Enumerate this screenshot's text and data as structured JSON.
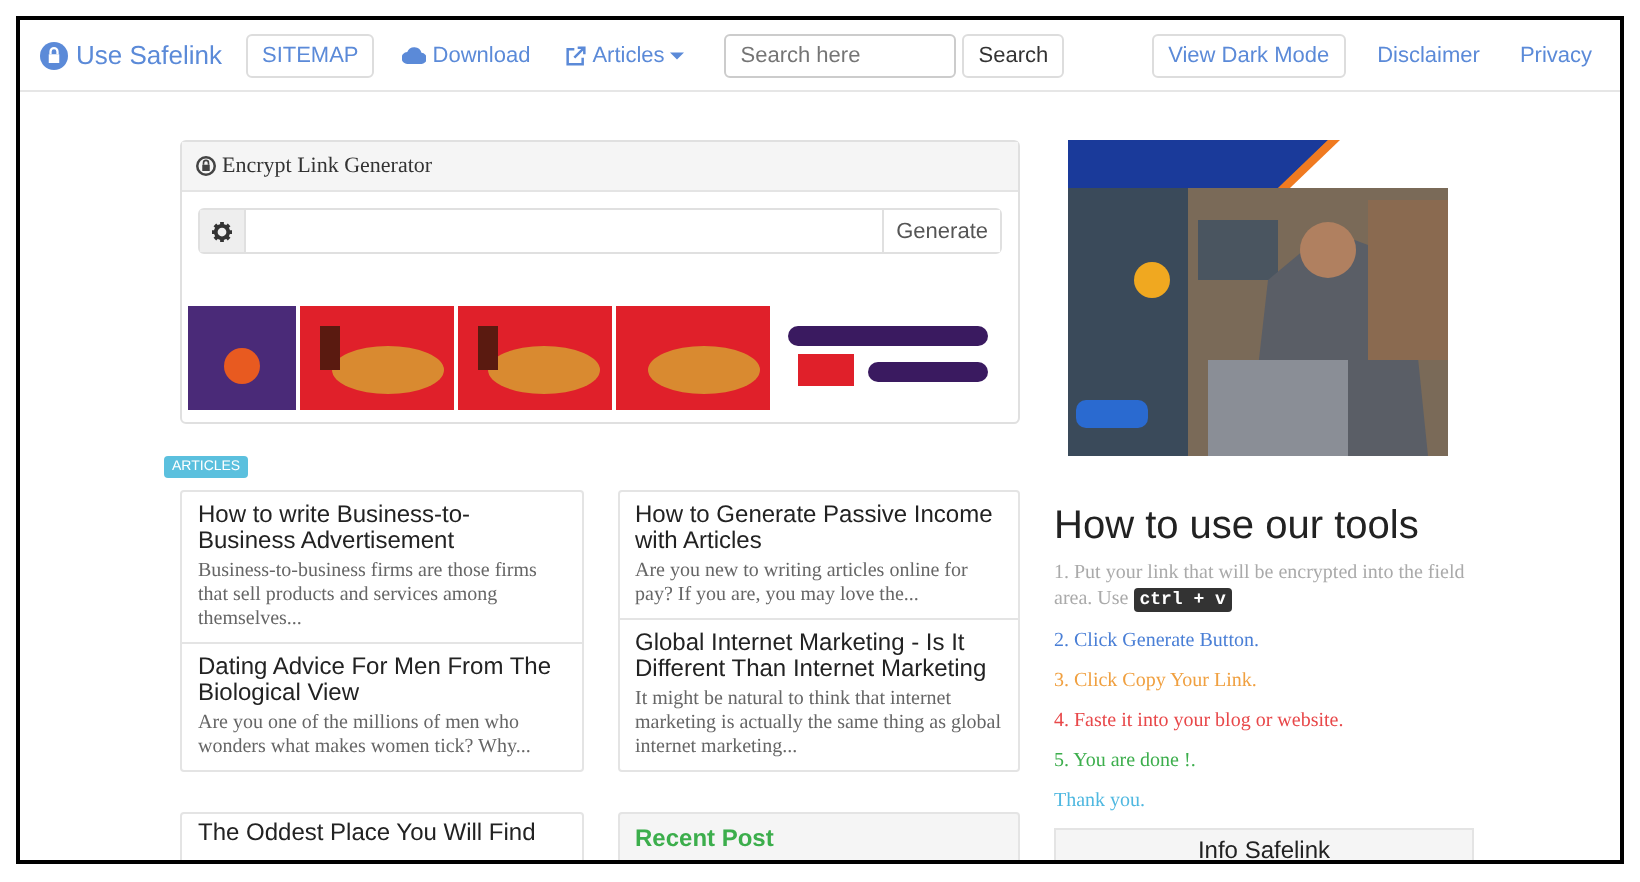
{
  "navbar": {
    "brand": "Use Safelink",
    "sitemap": "SITEMAP",
    "download": "Download",
    "articles": "Articles",
    "search": {
      "placeholder": "Search here",
      "button": "Search"
    },
    "dark_mode": "View Dark Mode",
    "disclaimer": "Disclaimer",
    "privacy": "Privacy"
  },
  "generator": {
    "title": "Encrypt Link Generator",
    "button": "Generate"
  },
  "articles": {
    "badge": "ARTICLES",
    "items": [
      {
        "title": "How to write Business-to-Business Advertisement",
        "excerpt": "Business-to-business firms are those firms that sell products and services among themselves..."
      },
      {
        "title": "Dating Advice For Men From The Biological View",
        "excerpt": "Are you one of the millions of men who wonders what makes women tick? Why..."
      },
      {
        "title": "How to Generate Passive Income with Articles",
        "excerpt": "Are you new to writing articles online for pay? If you are, you may love the..."
      },
      {
        "title": "Global Internet Marketing - Is It Different Than Internet Marketing",
        "excerpt": "It might be natural to think that internet marketing is actually the same thing as global internet marketing..."
      }
    ],
    "next_title": "The Oddest Place You Will Find",
    "recent_post": "Recent Post"
  },
  "sidebar": {
    "title": "How to use our tools",
    "steps": [
      {
        "text": "1. Put your link that will be encrypted into the field area. Use",
        "kbd": "ctrl + v",
        "color": "#aaaaaa"
      },
      {
        "text": "2. Click Generate Button.",
        "color": "#4a7fd6"
      },
      {
        "text": "3. Click Copy Your Link.",
        "color": "#f0a040"
      },
      {
        "text": "4. Faste it into your blog or website.",
        "color": "#e8484a"
      },
      {
        "text": "5. You are done !.",
        "color": "#3cae4c"
      },
      {
        "text": "Thank you.",
        "color": "#4fb8e0"
      }
    ],
    "info": "Info Safelink"
  }
}
